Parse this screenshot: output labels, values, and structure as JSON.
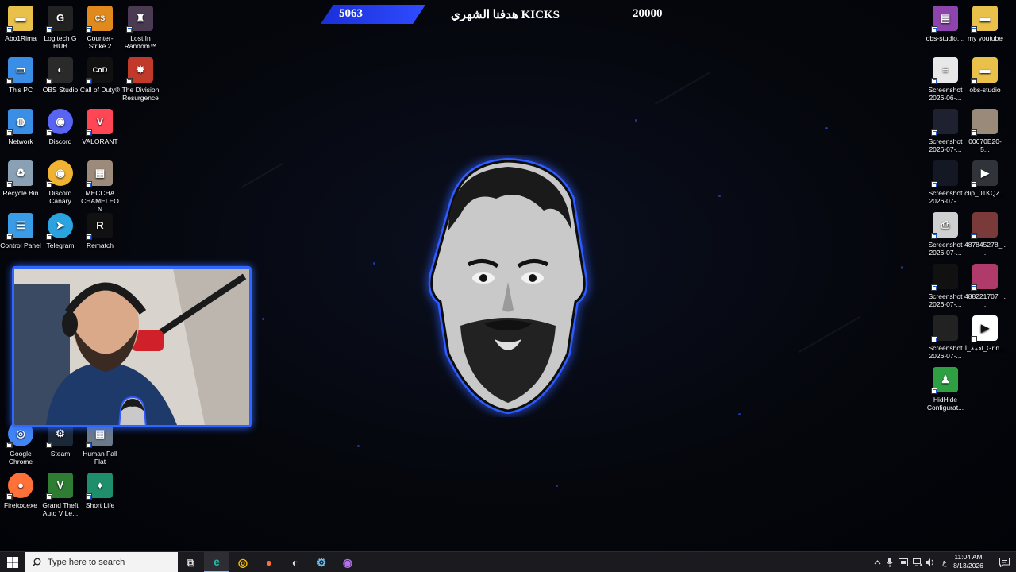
{
  "desktop": {
    "left_icons": [
      {
        "label": "Abo1Rima",
        "icon": "folder-user-icon",
        "color": "#e8c04a"
      },
      {
        "label": "Logitech G HUB",
        "icon": "logitech-g-icon",
        "color": "#222222"
      },
      {
        "label": "Counter-Strike 2",
        "icon": "counter-strike-icon",
        "color": "#e08a1e"
      },
      {
        "label": "Lost In Random™",
        "icon": "lost-in-random-icon",
        "color": "#4a3a52"
      },
      {
        "label": "This PC",
        "icon": "computer-icon",
        "color": "#3a8ee6"
      },
      {
        "label": "OBS Studio",
        "icon": "obs-icon",
        "color": "#2a2a2a"
      },
      {
        "label": "Call of Duty®",
        "icon": "call-of-duty-icon",
        "color": "#111111"
      },
      {
        "label": "The Division Resurgence",
        "icon": "division-icon",
        "color": "#c0392b"
      },
      {
        "label": "Network",
        "icon": "network-icon",
        "color": "#3a8ee6"
      },
      {
        "label": "Discord",
        "icon": "discord-icon",
        "color": "#5865f2"
      },
      {
        "label": "VALORANT",
        "icon": "valorant-icon",
        "color": "#ff4655"
      },
      {
        "label": "Recycle Bin",
        "icon": "recycle-bin-icon",
        "color": "#8aa0b4"
      },
      {
        "label": "Discord Canary",
        "icon": "discord-canary-icon",
        "color": "#f0b232"
      },
      {
        "label": "MECCHA CHAMELEON",
        "icon": "meccha-chameleon-icon",
        "color": "#9c8a7a"
      },
      {
        "label": "Control Panel",
        "icon": "control-panel-icon",
        "color": "#3a9be6"
      },
      {
        "label": "Telegram",
        "icon": "telegram-icon",
        "color": "#2aa3e0"
      },
      {
        "label": "Rematch",
        "icon": "rematch-icon",
        "color": "#111111"
      },
      {
        "label": "Google Chrome",
        "icon": "chrome-icon",
        "color": "#4285f4"
      },
      {
        "label": "Steam",
        "icon": "steam-icon",
        "color": "#1b2838"
      },
      {
        "label": "Human Fall Flat",
        "icon": "human-fall-flat-icon",
        "color": "#6a7a8a"
      },
      {
        "label": "Firefox.exe",
        "icon": "firefox-icon",
        "color": "#ff7139"
      },
      {
        "label": "Grand Theft Auto V Le...",
        "icon": "gta-v-icon",
        "color": "#2e7d32"
      },
      {
        "label": "Short Life",
        "icon": "short-life-icon",
        "color": "#1e8f6a"
      }
    ],
    "right_icons": [
      {
        "label": "obs-studio....",
        "icon": "winrar-icon",
        "color": "#8e44ad"
      },
      {
        "label": "my youtube",
        "icon": "folder-icon",
        "color": "#e8c04a"
      },
      {
        "label": "Screenshot 2026-06-...",
        "icon": "document-icon",
        "color": "#e8e8e8"
      },
      {
        "label": "obs-studio",
        "icon": "folder-icon",
        "color": "#e8c04a"
      },
      {
        "label": "Screenshot 2026-07-...",
        "icon": "screenshot-thumb-icon",
        "color": "#1e2130"
      },
      {
        "label": "00670E20-5...",
        "icon": "image-thumb-icon",
        "color": "#9a8a7a"
      },
      {
        "label": "Screenshot 2026-07-...",
        "icon": "screenshot-thumb-icon",
        "color": "#141824"
      },
      {
        "label": "clip_01KQZ...",
        "icon": "video-thumb-icon",
        "color": "#30343a"
      },
      {
        "label": "Screenshot 2026-07-...",
        "icon": "printer-doc-icon",
        "color": "#d0d0d0"
      },
      {
        "label": "487845278_...",
        "icon": "image-thumb-icon",
        "color": "#7a3a3a"
      },
      {
        "label": "Screenshot 2026-07-...",
        "icon": "screenshot-thumb-icon",
        "color": "#111111"
      },
      {
        "label": "488221707_...",
        "icon": "image-thumb-icon",
        "color": "#b03a6a"
      },
      {
        "label": "Screenshot 2026-07-...",
        "icon": "screenshot-thumb-icon",
        "color": "#222222"
      },
      {
        "label": "قمة_اl_Grin...",
        "icon": "media-file-icon",
        "color": "#ffffff"
      },
      {
        "label": "HidHide Configurat...",
        "icon": "hidhide-icon",
        "color": "#2ea043"
      }
    ]
  },
  "overlay": {
    "goal_count": "5063",
    "goal_title": "هدفنا الشهري KICKS",
    "goal_target": "20000",
    "accent": "#2f4cff"
  },
  "taskbar": {
    "search_placeholder": "Type here to search",
    "pinned": [
      {
        "icon": "task-view-icon"
      },
      {
        "icon": "edge-icon"
      },
      {
        "icon": "chrome-icon"
      },
      {
        "icon": "firefox-icon"
      },
      {
        "icon": "obs-icon"
      },
      {
        "icon": "steam-icon"
      },
      {
        "icon": "discord-canary-icon"
      }
    ],
    "keyboard_lang": "ع",
    "time": "11:04 AM",
    "date": "8/13/2026"
  }
}
